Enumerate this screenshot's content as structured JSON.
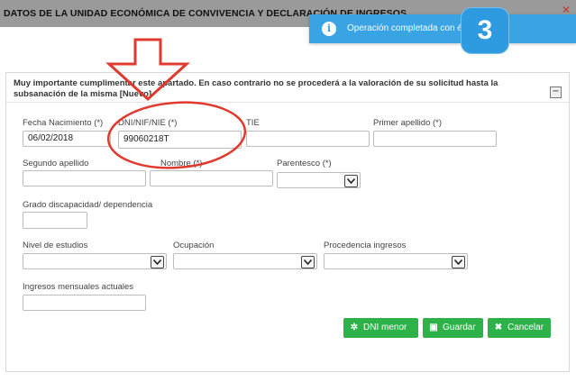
{
  "window": {
    "title": "DATOS DE LA UNIDAD ECONÓMICA DE CONVIVENCIA Y DECLARACIÓN DE INGRESOS"
  },
  "toast": {
    "message": "Operación completada con éxito",
    "icon": "info-icon",
    "color": "#3aa3e3"
  },
  "annotation": {
    "badge_number": "3",
    "arrow_color": "#e03a2f"
  },
  "panel": {
    "heading": "Muy importante cumplimentar este apartado. En caso contrario no se procederá a la valoración de su solicitud hasta la subsanación de la misma [Nuevo]",
    "collapse_label": "−"
  },
  "form": {
    "fecha_nacimiento": {
      "label": "Fecha Nacimiento (*)",
      "value": "06/02/2018"
    },
    "dni": {
      "label": "DNI/NIF/NIE (*)",
      "value": "99060218T"
    },
    "tie": {
      "label": "TIE",
      "value": ""
    },
    "primer_apellido": {
      "label": "Primer apellido (*)",
      "value": ""
    },
    "segundo_apellido": {
      "label": "Segundo apellido",
      "value": ""
    },
    "nombre": {
      "label": "Nombre (*)",
      "value": ""
    },
    "parentesco": {
      "label": "Parentesco (*)",
      "value": ""
    },
    "grado_discapacidad": {
      "label": "Grado discapacidad/ dependencia",
      "value": ""
    },
    "nivel_estudios": {
      "label": "Nivel de estudios",
      "value": ""
    },
    "ocupacion": {
      "label": "Ocupación",
      "value": ""
    },
    "procedencia_ingresos": {
      "label": "Procedencia ingresos",
      "value": ""
    },
    "ingresos_mensuales": {
      "label": "Ingresos mensuales actuales",
      "value": ""
    }
  },
  "buttons": {
    "dni_menor": "DNI menor",
    "guardar": "Guardar",
    "cancelar": "Cancelar",
    "color": "#2db24a"
  }
}
